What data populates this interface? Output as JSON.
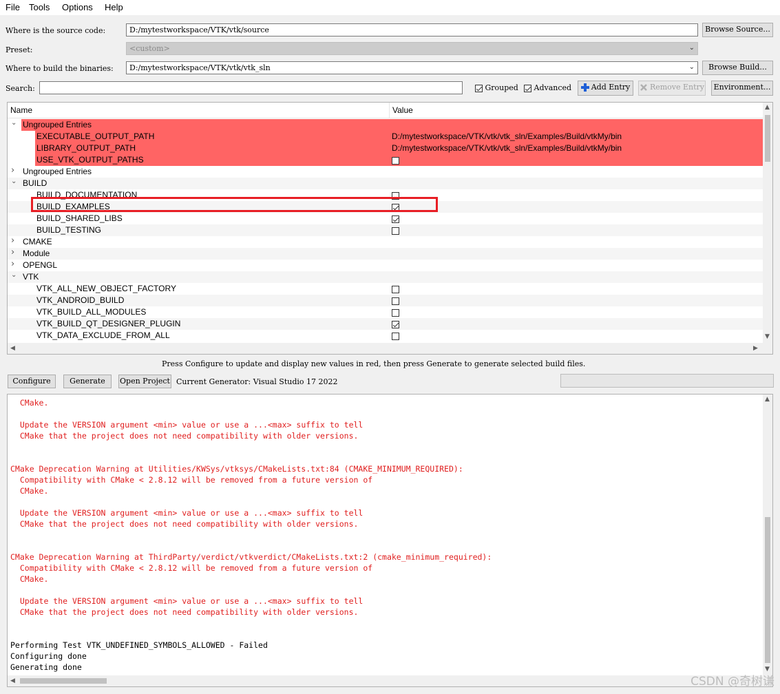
{
  "menu": [
    "File",
    "Tools",
    "Options",
    "Help"
  ],
  "source": {
    "label": "Where is the source code:",
    "value": "D:/mytestworkspace/VTK/vtk/source",
    "browse": "Browse Source..."
  },
  "preset": {
    "label": "Preset:",
    "value": "<custom>"
  },
  "build": {
    "label": "Where to build the binaries:",
    "value": "D:/mytestworkspace/VTK/vtk/vtk_sln",
    "browse": "Browse Build..."
  },
  "search": {
    "label": "Search:",
    "value": ""
  },
  "options": {
    "grouped": "Grouped",
    "advanced": "Advanced",
    "add_entry": "Add Entry",
    "remove_entry": "Remove Entry",
    "environment": "Environment..."
  },
  "tree": {
    "col_name": "Name",
    "col_value": "Value",
    "rows": [
      {
        "name": "Ungrouped Entries",
        "group": true,
        "expanded": true,
        "red": true
      },
      {
        "name": "EXECUTABLE_OUTPUT_PATH",
        "value": "D:/mytestworkspace/VTK/vtk/vtk_sln/Examples/Build/vtkMy/bin",
        "red": true
      },
      {
        "name": "LIBRARY_OUTPUT_PATH",
        "value": "D:/mytestworkspace/VTK/vtk/vtk_sln/Examples/Build/vtkMy/bin",
        "red": true
      },
      {
        "name": "USE_VTK_OUTPUT_PATHS",
        "check": false,
        "red": true
      },
      {
        "name": "Ungrouped Entries",
        "group": true,
        "expanded": false
      },
      {
        "name": "BUILD",
        "group": true,
        "expanded": true
      },
      {
        "name": "BUILD_DOCUMENTATION",
        "check": false
      },
      {
        "name": "BUILD_EXAMPLES",
        "check": true
      },
      {
        "name": "BUILD_SHARED_LIBS",
        "check": true
      },
      {
        "name": "BUILD_TESTING",
        "check": false
      },
      {
        "name": "CMAKE",
        "group": true,
        "expanded": false
      },
      {
        "name": "Module",
        "group": true,
        "expanded": false
      },
      {
        "name": "OPENGL",
        "group": true,
        "expanded": false
      },
      {
        "name": "VTK",
        "group": true,
        "expanded": true
      },
      {
        "name": "VTK_ALL_NEW_OBJECT_FACTORY",
        "check": false
      },
      {
        "name": "VTK_ANDROID_BUILD",
        "check": false
      },
      {
        "name": "VTK_BUILD_ALL_MODULES",
        "check": false
      },
      {
        "name": "VTK_BUILD_QT_DESIGNER_PLUGIN",
        "check": true
      },
      {
        "name": "VTK_DATA_EXCLUDE_FROM_ALL",
        "check": false
      }
    ]
  },
  "status_hint": "Press Configure to update and display new values in red, then press Generate to generate selected build files.",
  "actions": {
    "configure": "Configure",
    "generate": "Generate",
    "open_project": "Open Project",
    "generator": "Current Generator: Visual Studio 17 2022"
  },
  "output": [
    {
      "text": "  CMake.",
      "red": true
    },
    {
      "text": "",
      "red": false
    },
    {
      "text": "  Update the VERSION argument <min> value or use a ...<max> suffix to tell",
      "red": true
    },
    {
      "text": "  CMake that the project does not need compatibility with older versions.",
      "red": true
    },
    {
      "text": "",
      "red": false
    },
    {
      "text": "",
      "red": false
    },
    {
      "text": "CMake Deprecation Warning at Utilities/KWSys/vtksys/CMakeLists.txt:84 (CMAKE_MINIMUM_REQUIRED):",
      "red": true
    },
    {
      "text": "  Compatibility with CMake < 2.8.12 will be removed from a future version of",
      "red": true
    },
    {
      "text": "  CMake.",
      "red": true
    },
    {
      "text": "",
      "red": false
    },
    {
      "text": "  Update the VERSION argument <min> value or use a ...<max> suffix to tell",
      "red": true
    },
    {
      "text": "  CMake that the project does not need compatibility with older versions.",
      "red": true
    },
    {
      "text": "",
      "red": false
    },
    {
      "text": "",
      "red": false
    },
    {
      "text": "CMake Deprecation Warning at ThirdParty/verdict/vtkverdict/CMakeLists.txt:2 (cmake_minimum_required):",
      "red": true
    },
    {
      "text": "  Compatibility with CMake < 2.8.12 will be removed from a future version of",
      "red": true
    },
    {
      "text": "  CMake.",
      "red": true
    },
    {
      "text": "",
      "red": false
    },
    {
      "text": "  Update the VERSION argument <min> value or use a ...<max> suffix to tell",
      "red": true
    },
    {
      "text": "  CMake that the project does not need compatibility with older versions.",
      "red": true
    },
    {
      "text": "",
      "red": false
    },
    {
      "text": "",
      "red": false
    },
    {
      "text": "Performing Test VTK_UNDEFINED_SYMBOLS_ALLOWED - Failed",
      "red": false
    },
    {
      "text": "Configuring done",
      "red": false
    },
    {
      "text": "Generating done",
      "red": false
    }
  ],
  "watermark": "CSDN @奇树谦",
  "colors": {
    "changed_bg": "#ff6464",
    "highlight": "#e81e25",
    "warning_text": "#e02020"
  }
}
